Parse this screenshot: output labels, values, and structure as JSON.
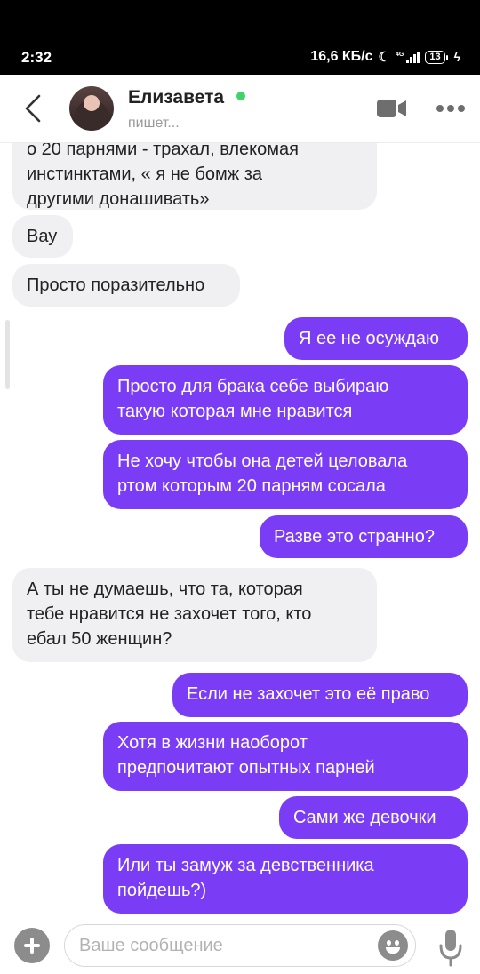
{
  "status_bar": {
    "time": "2:32",
    "speed": "16,6 КБ/с",
    "network_label": "4G",
    "battery": "13"
  },
  "header": {
    "contact_name": "Елизавета",
    "status": "пишет...",
    "online_color": "#3fd46b"
  },
  "messages": [
    {
      "dir": "in",
      "text": "о 20 парнями - трахал, влекомая\nинстинктами, « я не бомж за\nдругими донашивать»"
    },
    {
      "dir": "in",
      "text": "Вау"
    },
    {
      "dir": "in",
      "text": "Просто поразительно"
    },
    {
      "dir": "out",
      "text": "Я ее не осуждаю"
    },
    {
      "dir": "out",
      "text": "Просто для брака себе выбираю\nтакую которая мне нравится"
    },
    {
      "dir": "out",
      "text": "Не хочу чтобы она детей целовала\nртом которым 20 парням сосала"
    },
    {
      "dir": "out",
      "text": "Разве это странно?"
    },
    {
      "dir": "in",
      "text": "А ты не думаешь, что та, которая\nтебе нравится не захочет того, кто\nебал 50 женщин?"
    },
    {
      "dir": "out",
      "text": "Если не захочет это её право"
    },
    {
      "dir": "out",
      "text": "Хотя в жизни наоборот\nпредпочитают опытных парней"
    },
    {
      "dir": "out",
      "text": "Сами же девочки"
    },
    {
      "dir": "out",
      "text": "Или ты замуж за девственника\nпойдешь?)"
    }
  ],
  "composer": {
    "placeholder": "Ваше сообщение"
  },
  "colors": {
    "outgoing_bubble": "#7b3cf5",
    "incoming_bubble": "#f0f0f2"
  }
}
